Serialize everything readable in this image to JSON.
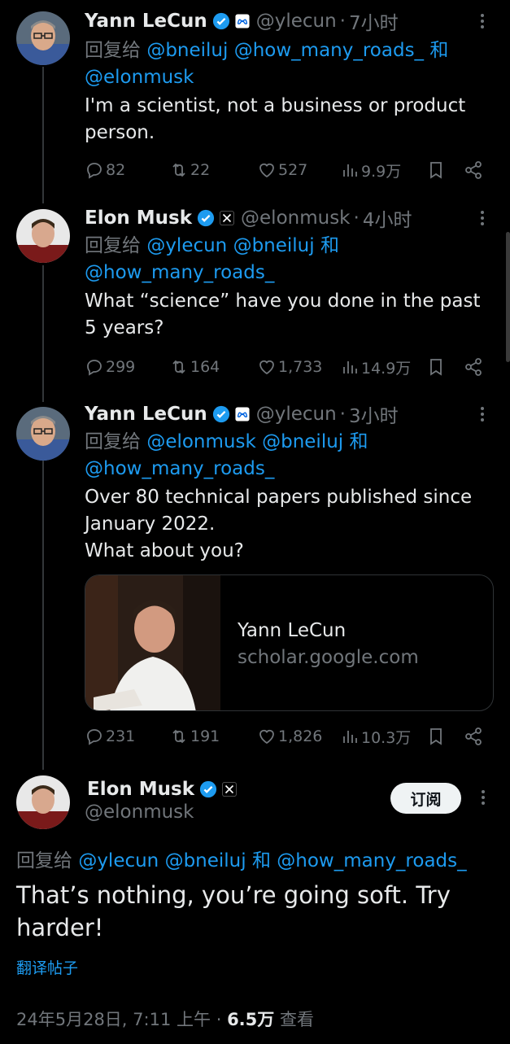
{
  "colors": {
    "accent": "#1d9bf0",
    "muted": "#71767b",
    "text": "#e7e9ea",
    "background": "#000000"
  },
  "tweets": [
    {
      "name": "Yann LeCun",
      "handle": "@ylecun",
      "time": "7小时",
      "reply_prefix": "回复给",
      "reply_to": [
        "@bneiluj",
        "@how_many_roads_"
      ],
      "reply_join": "和",
      "reply_last": "@elonmusk",
      "text": "I'm a scientist, not a business or product person.",
      "replies": "82",
      "retweets": "22",
      "likes": "527",
      "views": "9.9万",
      "affiliation_icon": "meta-icon"
    },
    {
      "name": "Elon Musk",
      "handle": "@elonmusk",
      "time": "4小时",
      "reply_prefix": "回复给",
      "reply_to": [
        "@ylecun",
        "@bneiluj"
      ],
      "reply_join": "和",
      "reply_last": "@how_many_roads_",
      "text": "What “science” have you done in the past 5 years?",
      "replies": "299",
      "retweets": "164",
      "likes": "1,733",
      "views": "14.9万",
      "affiliation_icon": "x-icon"
    },
    {
      "name": "Yann LeCun",
      "handle": "@ylecun",
      "time": "3小时",
      "reply_prefix": "回复给",
      "reply_to": [
        "@elonmusk",
        "@bneiluj"
      ],
      "reply_join": "和",
      "reply_last": "@how_many_roads_",
      "text_line1": "Over 80 technical papers published since January 2022.",
      "text_line2": "What about you?",
      "card_title": "Yann LeCun",
      "card_domain": "scholar.google.com",
      "replies": "231",
      "retweets": "191",
      "likes": "1,826",
      "views": "10.3万",
      "affiliation_icon": "meta-icon"
    }
  ],
  "main_tweet": {
    "name": "Elon Musk",
    "handle": "@elonmusk",
    "subscribe_label": "订阅",
    "reply_prefix": "回复给",
    "reply_to_1": "@ylecun",
    "reply_to_2": "@bneiluj",
    "reply_join": "和",
    "reply_to_3": "@how_many_roads_",
    "text": "That’s nothing, you’re going soft. Try harder!",
    "translate_label": "翻译帖子",
    "timestamp": "24年5月28日, 7:11 上午",
    "views_count": "6.5万",
    "views_label": "查看",
    "separator": "·",
    "affiliation_icon": "x-icon"
  }
}
